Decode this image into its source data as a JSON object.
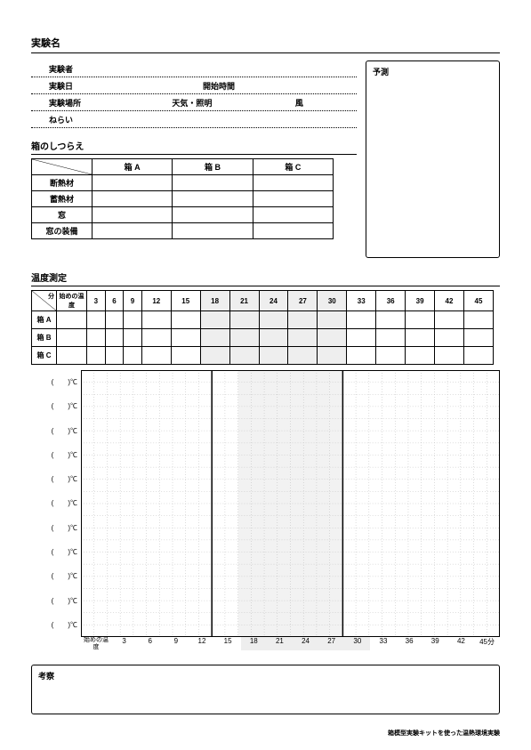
{
  "title": "実験名",
  "meta": {
    "experimenter": "実験者",
    "date": "実験日",
    "start_time": "開始時間",
    "place": "実験場所",
    "weather": "天気・照明",
    "wind": "風",
    "aim": "ねらい"
  },
  "setup": {
    "heading": "箱のしつらえ",
    "cols": [
      "箱 A",
      "箱 B",
      "箱 C"
    ],
    "rows": [
      "断熱材",
      "蓄熱材",
      "窓",
      "窓の装備"
    ]
  },
  "predict": {
    "label": "予測"
  },
  "measure": {
    "heading": "温度測定",
    "minute_label": "分",
    "init_label": "始めの温度",
    "rows": [
      "箱 A",
      "箱 B",
      "箱 C"
    ],
    "times": [
      3,
      6,
      9,
      12,
      15,
      18,
      21,
      24,
      27,
      30,
      33,
      36,
      39,
      42,
      45
    ],
    "shade_from": 18,
    "shade_to": 30
  },
  "chart_data": {
    "type": "line",
    "ylabel_template": "(　　)℃",
    "y_rows": 11,
    "x": [
      3,
      6,
      9,
      12,
      15,
      18,
      21,
      24,
      27,
      30,
      33,
      36,
      39,
      42,
      45
    ],
    "x_init_label": "始めの温度",
    "x_unit_last": "45分",
    "series": [],
    "shade_from": 18,
    "shade_to": 30
  },
  "consider": {
    "label": "考察"
  },
  "footer": "箱模型実験キットを使った温熱環境実験"
}
